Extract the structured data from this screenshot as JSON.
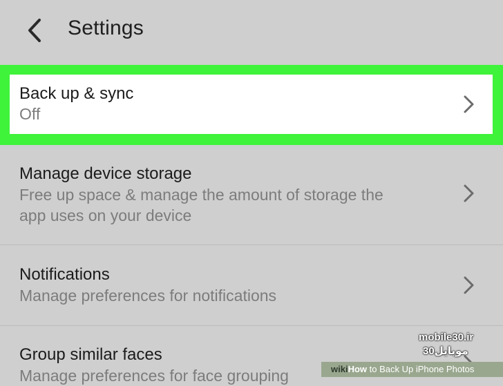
{
  "header": {
    "title": "Settings"
  },
  "icons": {
    "back": "chevron-left-icon",
    "row_arrow": "chevron-right-icon"
  },
  "colors": {
    "background": "#cfcfcf",
    "highlight": "#3ff23a",
    "card": "#ffffff",
    "primary_text": "#1b1b1b",
    "secondary_text": "#7c7c7c"
  },
  "settings": {
    "items": [
      {
        "title": "Back up & sync",
        "subtitle": "Off"
      },
      {
        "title": "Manage device storage",
        "subtitle_line1": "Free up space & manage the amount of storage the",
        "subtitle_line2": "app uses on your device"
      },
      {
        "title": "Notifications",
        "subtitle": "Manage preferences for notifications"
      },
      {
        "title": "Group similar faces",
        "subtitle": "Manage preferences for face grouping"
      }
    ]
  },
  "watermark": {
    "site": "mobile30.ir",
    "site_fa": "موبایل30",
    "wiki": "wiki",
    "how": "How",
    "caption": " to Back Up iPhone Photos"
  }
}
